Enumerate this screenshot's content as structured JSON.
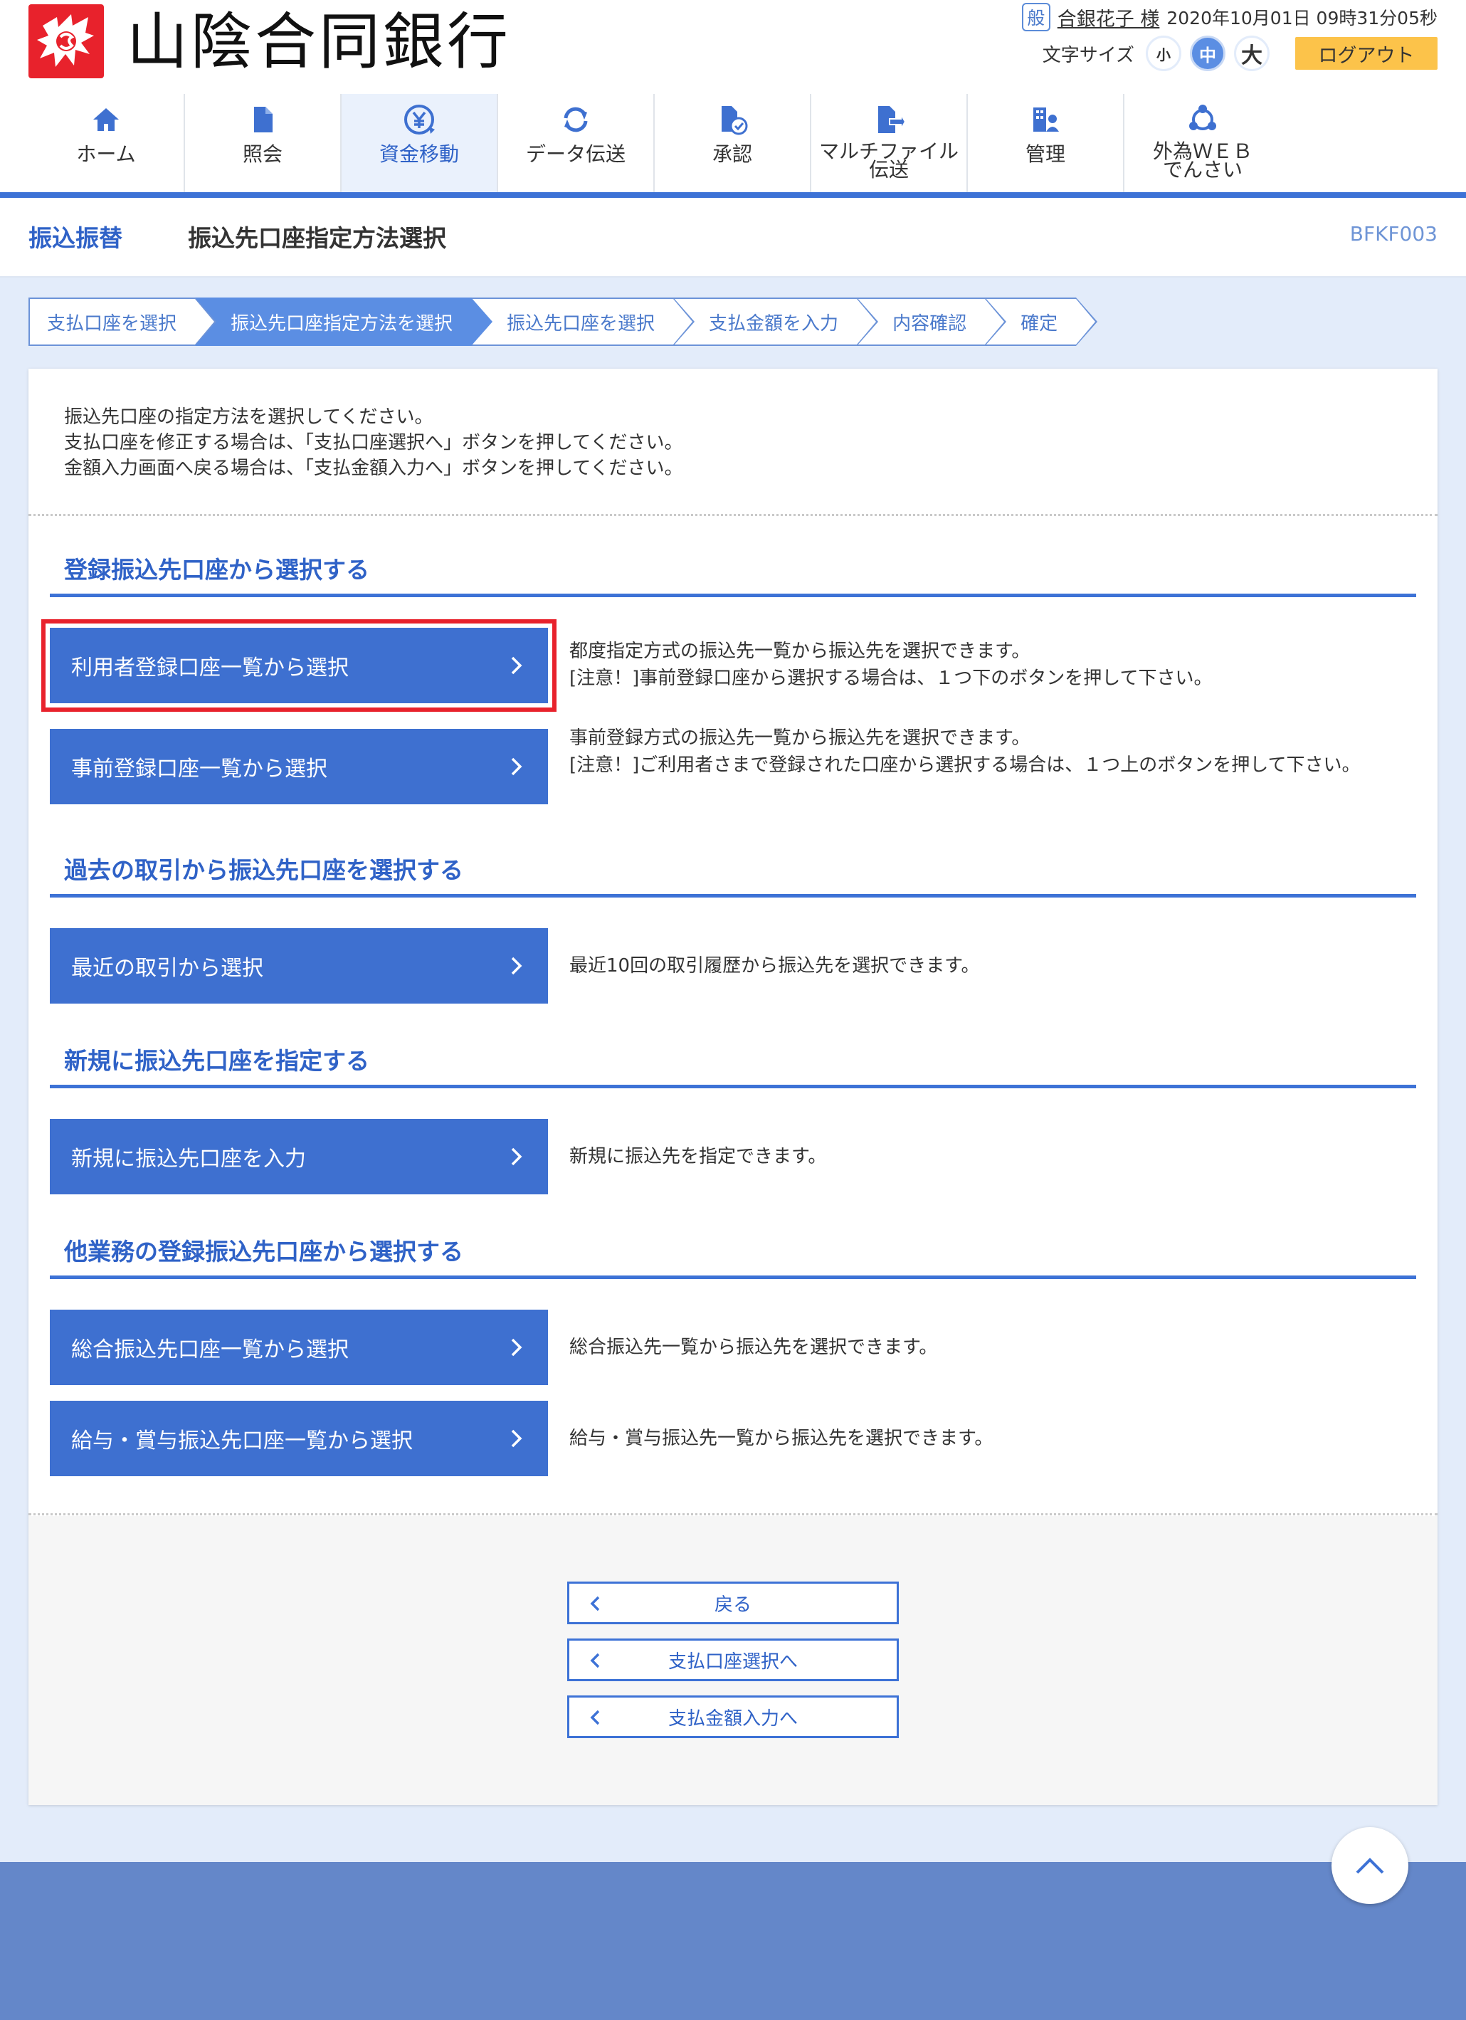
{
  "header": {
    "bank_name": "山陰合同銀行",
    "user_badge": "般",
    "user_name": "合銀花子 様",
    "login_datetime": "2020年10月01日 09時31分05秒",
    "font_size_label": "文字サイズ",
    "font_size_small": "小",
    "font_size_medium": "中",
    "font_size_large": "大",
    "font_size_selected": "中",
    "logout_label": "ログアウト"
  },
  "nav": {
    "items": [
      {
        "label": "ホーム",
        "icon": "home-icon"
      },
      {
        "label": "照会",
        "icon": "document-icon"
      },
      {
        "label": "資金移動",
        "icon": "yen-transfer-icon"
      },
      {
        "label": "データ伝送",
        "icon": "sync-icon"
      },
      {
        "label": "承認",
        "icon": "approval-icon"
      },
      {
        "label": "マルチファイル\n伝送",
        "icon": "file-transfer-icon"
      },
      {
        "label": "管理",
        "icon": "building-user-icon"
      },
      {
        "label": "外為ＷＥＢ\nでんさい",
        "icon": "network-icon"
      }
    ],
    "active": "資金移動"
  },
  "page": {
    "category": "振込振替",
    "title": "振込先口座指定方法選択",
    "screen_id": "BFKF003"
  },
  "steps": {
    "items": [
      "支払口座を選択",
      "振込先口座指定方法を選択",
      "振込先口座を選択",
      "支払金額を入力",
      "内容確認",
      "確定"
    ],
    "current": "振込先口座指定方法を選択"
  },
  "intro": {
    "line1": "振込先口座の指定方法を選択してください。",
    "line2": "支払口座を修正する場合は、「支払口座選択へ」ボタンを押してください。",
    "line3": "金額入力画面へ戻る場合は、「支払金額入力へ」ボタンを押してください。"
  },
  "sections": {
    "registered": {
      "title": "登録振込先口座から選択する",
      "user_list_button": "利用者登録口座一覧から選択",
      "user_list_desc1": "都度指定方式の振込先一覧から振込先を選択できます。",
      "user_list_desc2": "[注意！]事前登録口座から選択する場合は、１つ下のボタンを押して下さい。",
      "pre_list_button": "事前登録口座一覧から選択",
      "pre_list_desc1": "事前登録方式の振込先一覧から振込先を選択できます。",
      "pre_list_desc2": "[注意！]ご利用者さまで登録された口座から選択する場合は、１つ上のボタンを押して下さい。"
    },
    "history": {
      "title": "過去の取引から振込先口座を選択する",
      "button": "最近の取引から選択",
      "desc": "最近10回の取引履歴から振込先を選択できます。"
    },
    "new": {
      "title": "新規に振込先口座を指定する",
      "button": "新規に振込先口座を入力",
      "desc": "新規に振込先を指定できます。"
    },
    "other": {
      "title": "他業務の登録振込先口座から選択する",
      "general_button": "総合振込先口座一覧から選択",
      "general_desc": "総合振込先一覧から振込先を選択できます。",
      "salary_button": "給与・賞与振込先口座一覧から選択",
      "salary_desc": "給与・賞与振込先一覧から振込先を選択できます。"
    }
  },
  "footer_buttons": {
    "back": "戻る",
    "to_payment_account": "支払口座選択へ",
    "to_payment_amount": "支払金額入力へ"
  },
  "colors": {
    "primary": "#3e70d0",
    "accent_red": "#e8222c",
    "logout": "#fcc34a",
    "background": "#e3ecfa",
    "footer": "#6487c9"
  }
}
